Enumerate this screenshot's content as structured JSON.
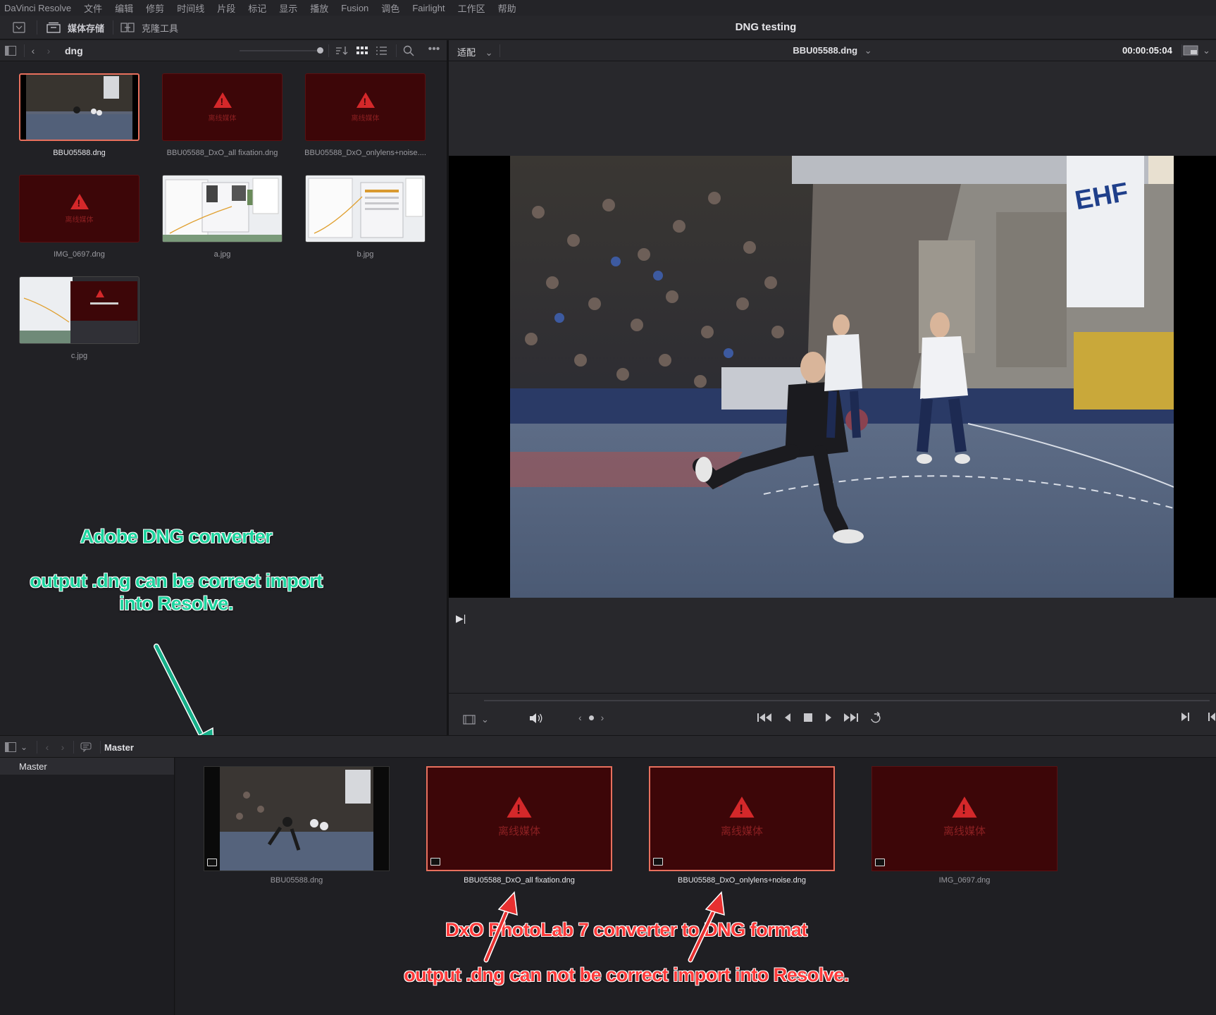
{
  "menu": [
    "DaVinci Resolve",
    "文件",
    "编辑",
    "修剪",
    "时间线",
    "片段",
    "标记",
    "显示",
    "播放",
    "Fusion",
    "调色",
    "Fairlight",
    "工作区",
    "帮助"
  ],
  "toolbar": {
    "media_storage": "媒体存储",
    "clone_tool": "克隆工具",
    "project_title": "DNG testing"
  },
  "media_pool": {
    "folder": "dng",
    "items": [
      {
        "name": "BBU05588.dng",
        "kind": "photo",
        "selected": true
      },
      {
        "name": "BBU05588_DxO_all fixation.dng",
        "kind": "offline"
      },
      {
        "name": "BBU05588_DxO_onlylens+noise....",
        "kind": "offline"
      },
      {
        "name": "IMG_0697.dng",
        "kind": "offline"
      },
      {
        "name": "a.jpg",
        "kind": "screenshot"
      },
      {
        "name": "b.jpg",
        "kind": "screenshot"
      },
      {
        "name": "c.jpg",
        "kind": "screenshot"
      }
    ],
    "offline_text": "离线媒体"
  },
  "viewer": {
    "fit": "适配",
    "clip_name": "BBU05588.dng",
    "timecode": "00:00:05:04"
  },
  "bin": {
    "path": "Master",
    "sidebar_items": [
      "Master"
    ],
    "items": [
      {
        "name": "BBU05588.dng",
        "kind": "photo"
      },
      {
        "name": "BBU05588_DxO_all fixation.dng",
        "kind": "offline",
        "highlight": true
      },
      {
        "name": "BBU05588_DxO_onlylens+noise.dng",
        "kind": "offline",
        "highlight": true
      },
      {
        "name": "IMG_0697.dng",
        "kind": "offline"
      }
    ],
    "offline_text": "离线媒体"
  },
  "annotations": {
    "adobe_title": "Adobe DNG converter",
    "adobe_line1": "output .dng can be correct import",
    "adobe_line2": "into Resolve.",
    "dxo_title": "DxO PhotoLab 7 converter to DNG format",
    "dxo_line": "output .dng can not be correct import into Resolve."
  },
  "colors": {
    "accent": "#e8705d",
    "offline_bg": "#3d0608",
    "warning": "#d4282a",
    "annot_green": "#1dd49e",
    "annot_red": "#ff3a3a"
  }
}
